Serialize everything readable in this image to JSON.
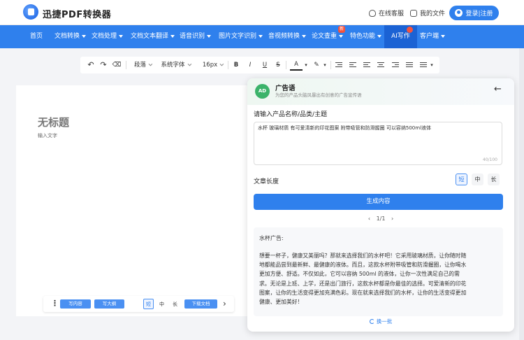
{
  "header": {
    "logo_text": "迅捷PDF转换器",
    "support_label": "在线客服",
    "docs_label": "我的文件",
    "login_label": "登录|注册"
  },
  "nav": {
    "items": [
      {
        "label": "首页"
      },
      {
        "label": "文档转换"
      },
      {
        "label": "文档处理"
      },
      {
        "label": "文档文本翻译"
      },
      {
        "label": "语音识别"
      },
      {
        "label": "图片文字识别"
      },
      {
        "label": "音视频转换"
      },
      {
        "label": "论文查重"
      },
      {
        "label": "特色功能"
      },
      {
        "label": "AI写作"
      },
      {
        "label": "客户端"
      }
    ],
    "new_badge": "新",
    "active_index": 9
  },
  "toolbar": {
    "paragraph": "段落",
    "font": "系统字体",
    "size": "16px",
    "bold": "B",
    "italic": "I",
    "underline": "U",
    "strike": "S",
    "font_color": "A"
  },
  "document": {
    "title": "无标题",
    "placeholder": "输入文字"
  },
  "doc_actions": {
    "more": "⋮",
    "write_outline": "写内容",
    "write_big": "写大纲",
    "len_short": "短",
    "len_mid": "中",
    "len_long": "长",
    "download": "下载文档",
    "next": "›"
  },
  "panel": {
    "icon_text": "AD",
    "title": "广告语",
    "desc": "为您的产品头脑风暴出有创意的广告宣传语",
    "back": "←",
    "input_label": "请输入产品名称/品类/主题",
    "input_value": "水杯 玻璃材质 有可爱清新的印花图案 附带吸管和防滑握圈 可以容纳500ml液体",
    "counter": "40/100",
    "length_label": "文章长度",
    "length_options": [
      "短",
      "中",
      "长"
    ],
    "length_selected": "短",
    "generate": "生成内容",
    "pager": "1/1",
    "result_title": "水杯广告:",
    "result_body": "想要一杯子，健康又美丽吗？那就来选择我们的水杯吧！它采用玻璃材质，让你随时随地都能品尝到最新鲜、最健康的液体。而且，这款水杯附带吸管和防滑握圈，让你喝水更加方便、舒适。不仅如此，它可以容纳 500ml 的液体，让你一次性满足自己的需求。无论是上班、上学，还是出门旅行，这款水杯都是你最佳的选择。可爱清新的印花图案，让你的生活变得更加充满色彩。现在就来选择我们的水杯，让你的生活变得更加健康、更加美好！",
    "refresh": "换一批"
  },
  "colors": {
    "brand": "#2f80ed",
    "badge": "#f5533d",
    "ad_icon": "#3bb36a"
  }
}
